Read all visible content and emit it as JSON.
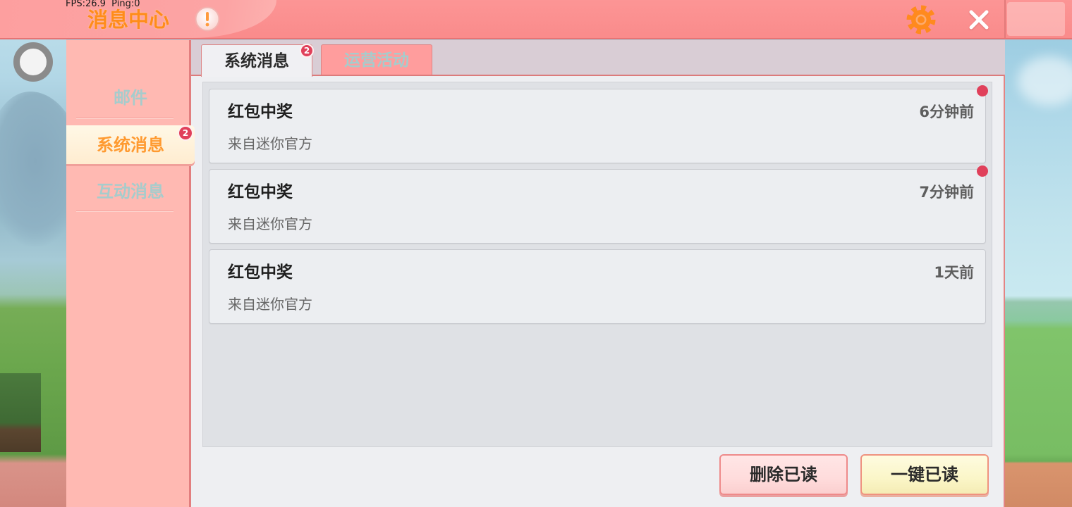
{
  "hud": {
    "fps_ping": "FPS:26.9  Ping:0",
    "ring_icon": "ring-icon"
  },
  "header": {
    "title": "消息中心",
    "notice_icon": "exclamation-icon",
    "settings_icon": "gear-icon",
    "close_icon": "close-icon"
  },
  "sidebar": {
    "items": [
      {
        "label": "邮件",
        "selected": false
      },
      {
        "label": "系统消息",
        "selected": true,
        "badge": "2"
      },
      {
        "label": "互动消息",
        "selected": false
      }
    ]
  },
  "tabs": [
    {
      "label": "系统消息",
      "active": true,
      "badge": "2"
    },
    {
      "label": "运营活动",
      "active": false
    }
  ],
  "messages": [
    {
      "title": "红包中奖",
      "time": "6分钟前",
      "source": "来自迷你官方",
      "unread": true
    },
    {
      "title": "红包中奖",
      "time": "7分钟前",
      "source": "来自迷你官方",
      "unread": true
    },
    {
      "title": "红包中奖",
      "time": "1天前",
      "source": "来自迷你官方",
      "unread": false
    }
  ],
  "actions": {
    "delete_read": "删除已读",
    "mark_all_read": "一键已读"
  },
  "colors": {
    "header_bg": "#fa8b8b",
    "title_orange": "#ff8c1a",
    "sidebar_bg": "#ffb9b2",
    "selected_text": "#ff9a30",
    "inactive_text": "#a6cccc",
    "badge_red": "#e0405a",
    "content_bg": "#eeeff2",
    "list_bg": "#dfe1e5",
    "card_bg": "#eceef1",
    "tab_inactive_bg": "#ff9d9d",
    "delete_button_bg": "#ffdcdc",
    "read_all_button_bg": "#fbf6c8"
  }
}
